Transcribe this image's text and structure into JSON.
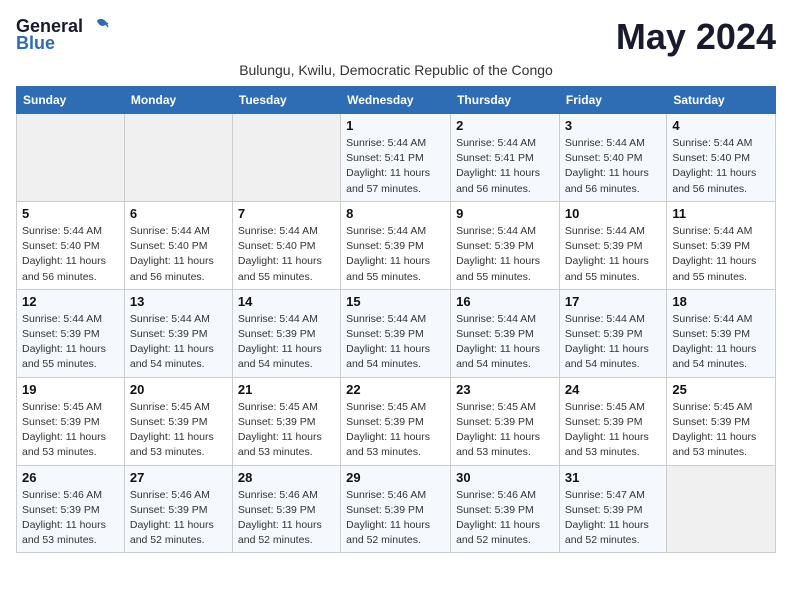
{
  "header": {
    "logo_general": "General",
    "logo_blue": "Blue",
    "month_title": "May 2024",
    "subtitle": "Bulungu, Kwilu, Democratic Republic of the Congo"
  },
  "weekdays": [
    "Sunday",
    "Monday",
    "Tuesday",
    "Wednesday",
    "Thursday",
    "Friday",
    "Saturday"
  ],
  "weeks": [
    [
      {
        "day": "",
        "sunrise": "",
        "sunset": "",
        "daylight": ""
      },
      {
        "day": "",
        "sunrise": "",
        "sunset": "",
        "daylight": ""
      },
      {
        "day": "",
        "sunrise": "",
        "sunset": "",
        "daylight": ""
      },
      {
        "day": "1",
        "sunrise": "Sunrise: 5:44 AM",
        "sunset": "Sunset: 5:41 PM",
        "daylight": "Daylight: 11 hours and 57 minutes."
      },
      {
        "day": "2",
        "sunrise": "Sunrise: 5:44 AM",
        "sunset": "Sunset: 5:41 PM",
        "daylight": "Daylight: 11 hours and 56 minutes."
      },
      {
        "day": "3",
        "sunrise": "Sunrise: 5:44 AM",
        "sunset": "Sunset: 5:40 PM",
        "daylight": "Daylight: 11 hours and 56 minutes."
      },
      {
        "day": "4",
        "sunrise": "Sunrise: 5:44 AM",
        "sunset": "Sunset: 5:40 PM",
        "daylight": "Daylight: 11 hours and 56 minutes."
      }
    ],
    [
      {
        "day": "5",
        "sunrise": "Sunrise: 5:44 AM",
        "sunset": "Sunset: 5:40 PM",
        "daylight": "Daylight: 11 hours and 56 minutes."
      },
      {
        "day": "6",
        "sunrise": "Sunrise: 5:44 AM",
        "sunset": "Sunset: 5:40 PM",
        "daylight": "Daylight: 11 hours and 56 minutes."
      },
      {
        "day": "7",
        "sunrise": "Sunrise: 5:44 AM",
        "sunset": "Sunset: 5:40 PM",
        "daylight": "Daylight: 11 hours and 55 minutes."
      },
      {
        "day": "8",
        "sunrise": "Sunrise: 5:44 AM",
        "sunset": "Sunset: 5:39 PM",
        "daylight": "Daylight: 11 hours and 55 minutes."
      },
      {
        "day": "9",
        "sunrise": "Sunrise: 5:44 AM",
        "sunset": "Sunset: 5:39 PM",
        "daylight": "Daylight: 11 hours and 55 minutes."
      },
      {
        "day": "10",
        "sunrise": "Sunrise: 5:44 AM",
        "sunset": "Sunset: 5:39 PM",
        "daylight": "Daylight: 11 hours and 55 minutes."
      },
      {
        "day": "11",
        "sunrise": "Sunrise: 5:44 AM",
        "sunset": "Sunset: 5:39 PM",
        "daylight": "Daylight: 11 hours and 55 minutes."
      }
    ],
    [
      {
        "day": "12",
        "sunrise": "Sunrise: 5:44 AM",
        "sunset": "Sunset: 5:39 PM",
        "daylight": "Daylight: 11 hours and 55 minutes."
      },
      {
        "day": "13",
        "sunrise": "Sunrise: 5:44 AM",
        "sunset": "Sunset: 5:39 PM",
        "daylight": "Daylight: 11 hours and 54 minutes."
      },
      {
        "day": "14",
        "sunrise": "Sunrise: 5:44 AM",
        "sunset": "Sunset: 5:39 PM",
        "daylight": "Daylight: 11 hours and 54 minutes."
      },
      {
        "day": "15",
        "sunrise": "Sunrise: 5:44 AM",
        "sunset": "Sunset: 5:39 PM",
        "daylight": "Daylight: 11 hours and 54 minutes."
      },
      {
        "day": "16",
        "sunrise": "Sunrise: 5:44 AM",
        "sunset": "Sunset: 5:39 PM",
        "daylight": "Daylight: 11 hours and 54 minutes."
      },
      {
        "day": "17",
        "sunrise": "Sunrise: 5:44 AM",
        "sunset": "Sunset: 5:39 PM",
        "daylight": "Daylight: 11 hours and 54 minutes."
      },
      {
        "day": "18",
        "sunrise": "Sunrise: 5:44 AM",
        "sunset": "Sunset: 5:39 PM",
        "daylight": "Daylight: 11 hours and 54 minutes."
      }
    ],
    [
      {
        "day": "19",
        "sunrise": "Sunrise: 5:45 AM",
        "sunset": "Sunset: 5:39 PM",
        "daylight": "Daylight: 11 hours and 53 minutes."
      },
      {
        "day": "20",
        "sunrise": "Sunrise: 5:45 AM",
        "sunset": "Sunset: 5:39 PM",
        "daylight": "Daylight: 11 hours and 53 minutes."
      },
      {
        "day": "21",
        "sunrise": "Sunrise: 5:45 AM",
        "sunset": "Sunset: 5:39 PM",
        "daylight": "Daylight: 11 hours and 53 minutes."
      },
      {
        "day": "22",
        "sunrise": "Sunrise: 5:45 AM",
        "sunset": "Sunset: 5:39 PM",
        "daylight": "Daylight: 11 hours and 53 minutes."
      },
      {
        "day": "23",
        "sunrise": "Sunrise: 5:45 AM",
        "sunset": "Sunset: 5:39 PM",
        "daylight": "Daylight: 11 hours and 53 minutes."
      },
      {
        "day": "24",
        "sunrise": "Sunrise: 5:45 AM",
        "sunset": "Sunset: 5:39 PM",
        "daylight": "Daylight: 11 hours and 53 minutes."
      },
      {
        "day": "25",
        "sunrise": "Sunrise: 5:45 AM",
        "sunset": "Sunset: 5:39 PM",
        "daylight": "Daylight: 11 hours and 53 minutes."
      }
    ],
    [
      {
        "day": "26",
        "sunrise": "Sunrise: 5:46 AM",
        "sunset": "Sunset: 5:39 PM",
        "daylight": "Daylight: 11 hours and 53 minutes."
      },
      {
        "day": "27",
        "sunrise": "Sunrise: 5:46 AM",
        "sunset": "Sunset: 5:39 PM",
        "daylight": "Daylight: 11 hours and 52 minutes."
      },
      {
        "day": "28",
        "sunrise": "Sunrise: 5:46 AM",
        "sunset": "Sunset: 5:39 PM",
        "daylight": "Daylight: 11 hours and 52 minutes."
      },
      {
        "day": "29",
        "sunrise": "Sunrise: 5:46 AM",
        "sunset": "Sunset: 5:39 PM",
        "daylight": "Daylight: 11 hours and 52 minutes."
      },
      {
        "day": "30",
        "sunrise": "Sunrise: 5:46 AM",
        "sunset": "Sunset: 5:39 PM",
        "daylight": "Daylight: 11 hours and 52 minutes."
      },
      {
        "day": "31",
        "sunrise": "Sunrise: 5:47 AM",
        "sunset": "Sunset: 5:39 PM",
        "daylight": "Daylight: 11 hours and 52 minutes."
      },
      {
        "day": "",
        "sunrise": "",
        "sunset": "",
        "daylight": ""
      }
    ]
  ]
}
